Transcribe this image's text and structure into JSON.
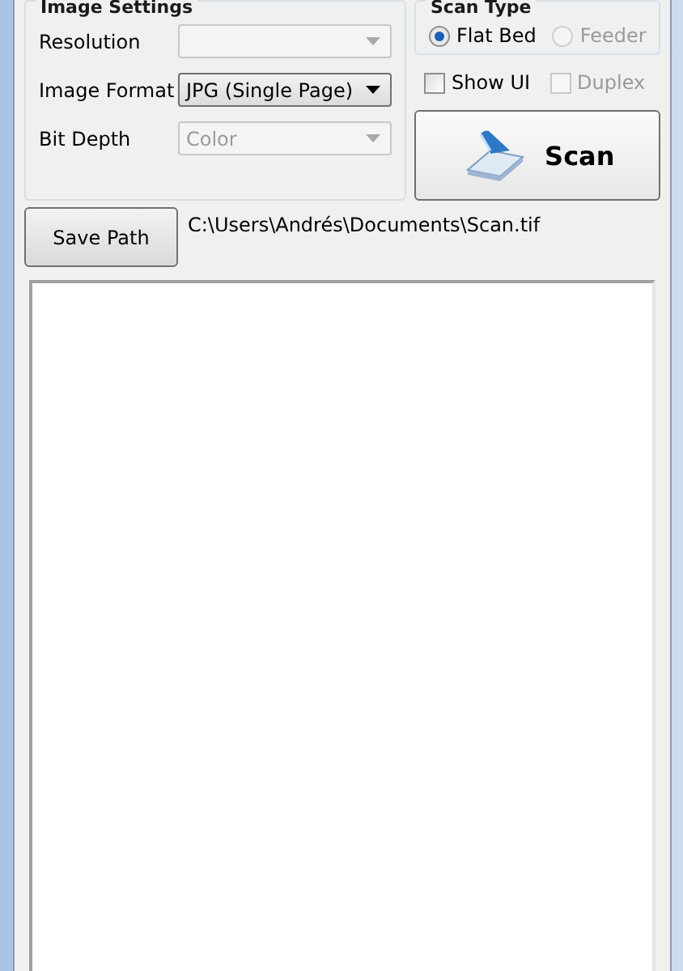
{
  "image_settings": {
    "title": "Image Settings",
    "fields": [
      {
        "label": "Resolution",
        "disabled": true
      },
      {
        "label": "Image Format",
        "value": "JPG (Single Page)",
        "disabled": false
      },
      {
        "label": "Bit Depth",
        "value": "Color",
        "disabled": true
      }
    ]
  },
  "scan_type": {
    "title": "Scan Type",
    "options": [
      {
        "label": "Flat Bed",
        "selected": true,
        "disabled": false
      },
      {
        "label": "Feeder",
        "selected": false,
        "disabled": true
      }
    ]
  },
  "checkboxes": [
    {
      "label": "Show UI",
      "checked": false,
      "disabled": false
    },
    {
      "label": "Duplex",
      "checked": false,
      "disabled": true
    }
  ],
  "scan_button": {
    "label": "Scan"
  },
  "save_path": {
    "button": "Save Path",
    "path": "C:\\Users\\Andrés\\Documents\\Scan.tif"
  }
}
